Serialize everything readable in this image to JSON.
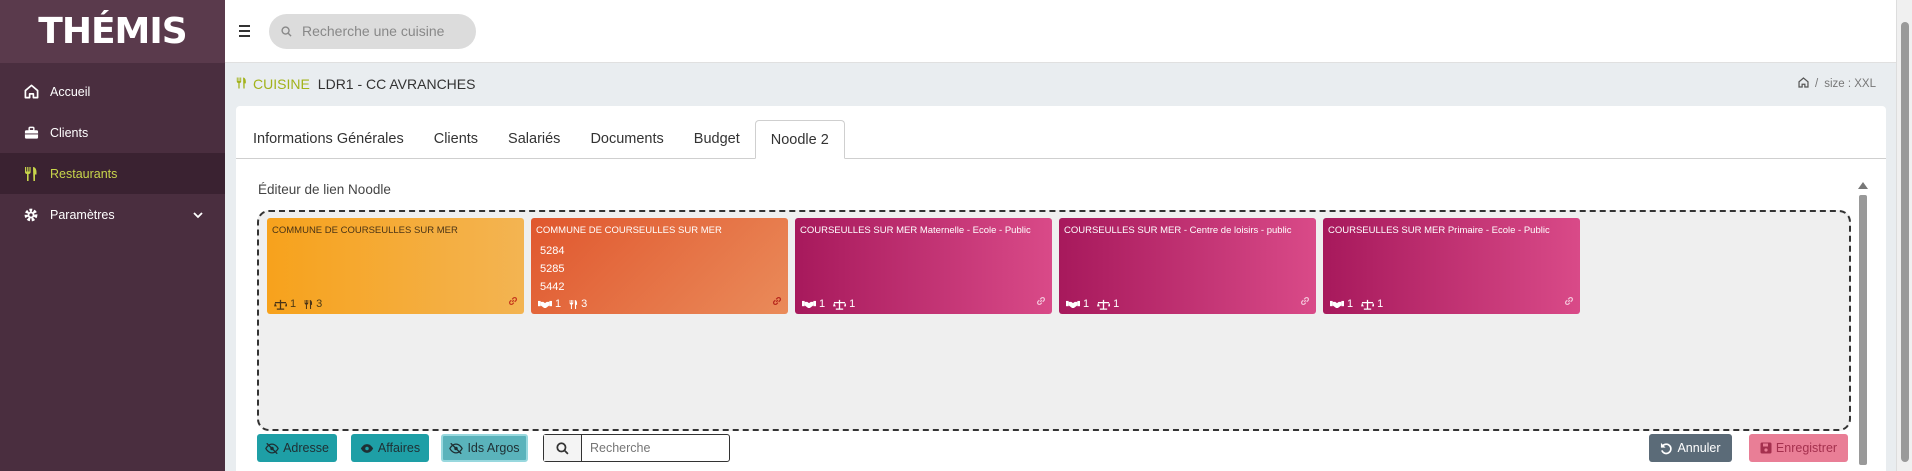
{
  "app": {
    "logo": "THÉMIS"
  },
  "sidebar": {
    "items": [
      {
        "label": "Accueil",
        "icon": "home-icon",
        "active": false
      },
      {
        "label": "Clients",
        "icon": "briefcase-icon",
        "active": false
      },
      {
        "label": "Restaurants",
        "icon": "utensils-icon",
        "active": true
      },
      {
        "label": "Paramètres",
        "icon": "gear-icon",
        "active": false,
        "has_submenu": true
      }
    ]
  },
  "topbar": {
    "search_placeholder": "Recherche une cuisine"
  },
  "breadcrumb": {
    "kind": "CUISINE",
    "name": "LDR1 - CC AVRANCHES",
    "size_label": "size : XXL"
  },
  "tabs": [
    {
      "label": "Informations Générales",
      "active": false
    },
    {
      "label": "Clients",
      "active": false
    },
    {
      "label": "Salariés",
      "active": false
    },
    {
      "label": "Documents",
      "active": false
    },
    {
      "label": "Budget",
      "active": false
    },
    {
      "label": "Noodle 2",
      "active": true
    }
  ],
  "editor": {
    "title": "Éditeur de lien Noodle",
    "cards": [
      {
        "title": "COMMUNE DE COURSEULLES SUR MER",
        "ids": [],
        "stats": [
          {
            "icon": "balance-icon",
            "value": "1"
          },
          {
            "icon": "utensils-icon",
            "value": "3"
          }
        ]
      },
      {
        "title": "COMMUNE DE COURSEULLES SUR MER",
        "ids": [
          "5284",
          "5285",
          "5442"
        ],
        "stats": [
          {
            "icon": "handshake-icon",
            "value": "1"
          },
          {
            "icon": "utensils-icon",
            "value": "3"
          }
        ]
      },
      {
        "title": "COURSEULLES SUR MER Maternelle - Ecole - Public",
        "ids": [],
        "stats": [
          {
            "icon": "handshake-icon",
            "value": "1"
          },
          {
            "icon": "balance-icon",
            "value": "1"
          }
        ]
      },
      {
        "title": "COURSEULLES SUR MER - Centre de loisirs - public",
        "ids": [],
        "stats": [
          {
            "icon": "handshake-icon",
            "value": "1"
          },
          {
            "icon": "balance-icon",
            "value": "1"
          }
        ]
      },
      {
        "title": "COURSEULLES SUR MER Primaire - Ecole - Public",
        "ids": [],
        "stats": [
          {
            "icon": "handshake-icon",
            "value": "1"
          },
          {
            "icon": "balance-icon",
            "value": "1"
          }
        ]
      }
    ]
  },
  "toolbar": {
    "adresse_label": "Adresse",
    "affaires_label": "Affaires",
    "ids_argos_label": "Ids Argos",
    "search_placeholder": "Recherche",
    "annuler_label": "Annuler",
    "enregistrer_label": "Enregistrer"
  },
  "colors": {
    "sidebar_bg": "#4a2e3f",
    "accent_green": "#a2b21a",
    "teal_button": "#1e9fa6",
    "card_orange": "#f7a21c",
    "card_coral": "#e0572e",
    "card_magenta": "#c02d72"
  }
}
